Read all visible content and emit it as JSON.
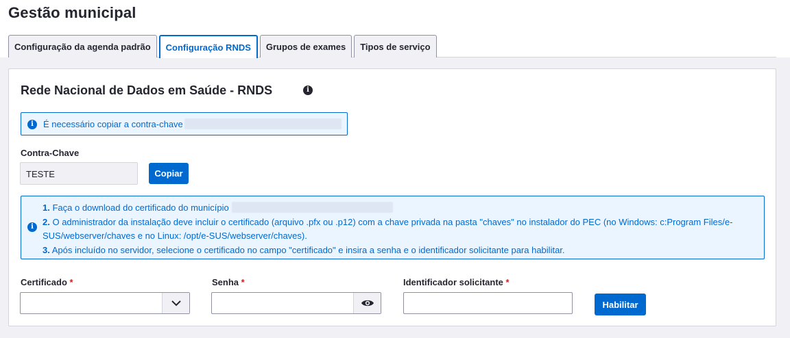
{
  "page": {
    "title": "Gestão municipal"
  },
  "tabs": [
    {
      "label": "Configuração da agenda padrão",
      "active": false
    },
    {
      "label": "Configuração RNDS",
      "active": true
    },
    {
      "label": "Grupos de exames",
      "active": false
    },
    {
      "label": "Tipos de serviço",
      "active": false
    }
  ],
  "section": {
    "title": "Rede Nacional de Dados em Saúde - RNDS",
    "info_icon": "info-icon"
  },
  "alert_top": {
    "text": "É necessário copiar a contra-chave"
  },
  "key": {
    "label": "Contra-Chave",
    "value": "TESTE",
    "copy_label": "Copiar"
  },
  "instructions": {
    "line1_num": "1.",
    "line1": "Faça o download do certificado do município",
    "line2_num": "2.",
    "line2a": "O administrador da instalação deve incluir o certificado (arquivo .pfx ou .p12) com a chave privada na pasta \"chaves\" no instalador do PEC (no Windows: c:Program Files/e-",
    "line2b": "SUS/webserver/chaves e no Linux: /opt/e-SUS/webserver/chaves).",
    "line3_num": "3.",
    "line3": "Após incluído no servidor, selecione o certificado no campo \"certificado\" e insira a senha e o identificador solicitante para habilitar."
  },
  "form": {
    "certificate_label": "Certificado",
    "password_label": "Senha",
    "requester_label": "Identificador solicitante",
    "required_mark": "*",
    "certificate_value": "",
    "password_value": "",
    "requester_value": "",
    "enable_label": "Habilitar"
  },
  "colors": {
    "primary": "#0069d0",
    "required": "#d01e1e",
    "alert_bg": "#ebf5ff"
  }
}
